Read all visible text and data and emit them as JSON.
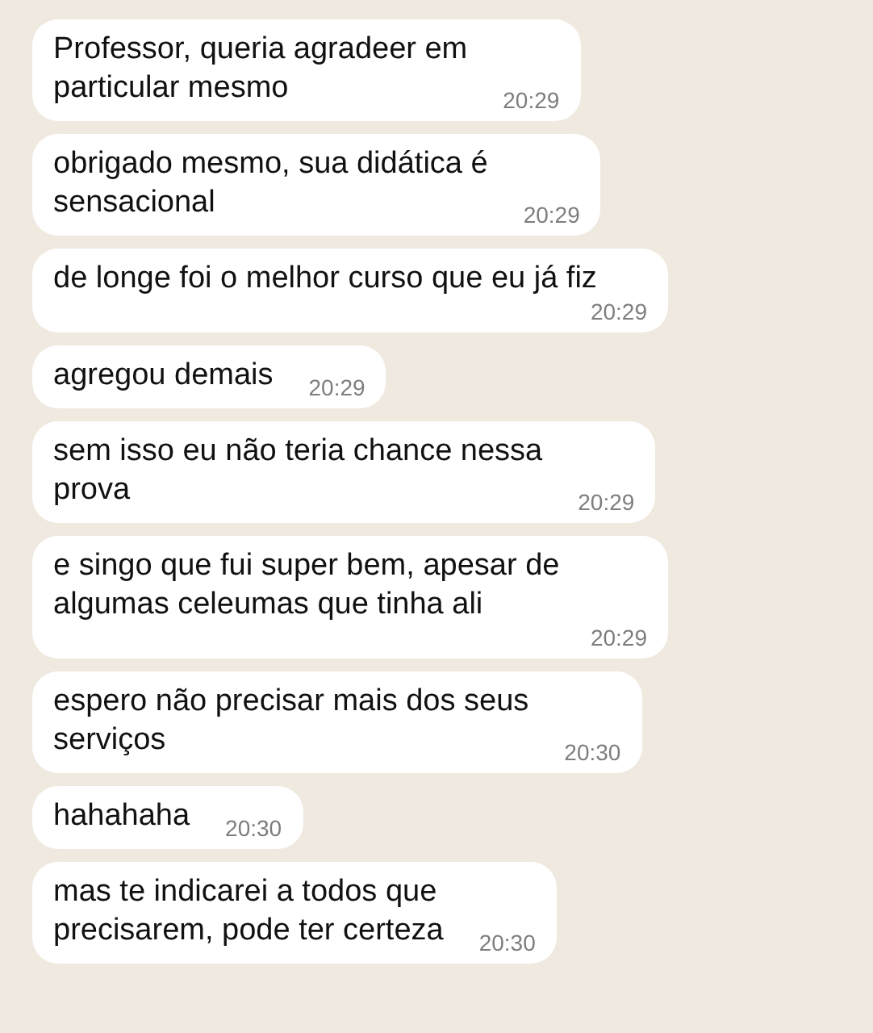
{
  "messages": [
    {
      "lines": [
        "Professor, queria agradeer em",
        "particular mesmo"
      ],
      "time": "20:29"
    },
    {
      "lines": [
        "obrigado mesmo, sua didática é",
        "sensacional"
      ],
      "time": "20:29"
    },
    {
      "lines": [
        "de longe foi o melhor curso que eu já fiz"
      ],
      "time": "20:29"
    },
    {
      "lines": [
        "agregou demais"
      ],
      "time": "20:29"
    },
    {
      "lines": [
        "sem isso eu não teria chance nessa",
        "prova"
      ],
      "time": "20:29"
    },
    {
      "lines": [
        "e singo que fui super bem, apesar de",
        "algumas celeumas que tinha ali"
      ],
      "time": "20:29"
    },
    {
      "lines": [
        "espero não precisar mais dos seus",
        "serviços"
      ],
      "time": "20:30"
    },
    {
      "lines": [
        "hahahaha"
      ],
      "time": "20:30"
    },
    {
      "lines": [
        "mas te indicarei a todos que",
        "precisarem, pode ter certeza"
      ],
      "time": "20:30"
    }
  ]
}
